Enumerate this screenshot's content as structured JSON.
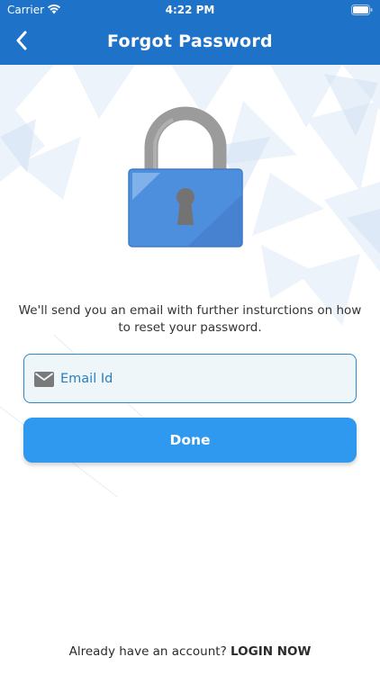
{
  "status_bar": {
    "carrier": "Carrier",
    "time": "4:22 PM",
    "icons": [
      "wifi-icon",
      "battery-icon"
    ]
  },
  "nav": {
    "title": "Forgot Password",
    "back_icon": "chevron-left-icon"
  },
  "illustration": {
    "icon": "padlock-icon"
  },
  "instructions": "We'll send you an email with further insturctions on how to reset your password.",
  "email_field": {
    "icon": "mail-icon",
    "placeholder": "Email Id",
    "value": ""
  },
  "done_button": {
    "label": "Done"
  },
  "footer": {
    "prompt": "Already have an account?",
    "link": "LOGIN NOW"
  },
  "colors": {
    "primary": "#1e73c9",
    "button": "#2f98ef",
    "field_border": "#2f86c9",
    "field_text": "#2a7fbf",
    "lock_body": "#4e8fdd",
    "lock_shackle": "#9a9a9a"
  }
}
